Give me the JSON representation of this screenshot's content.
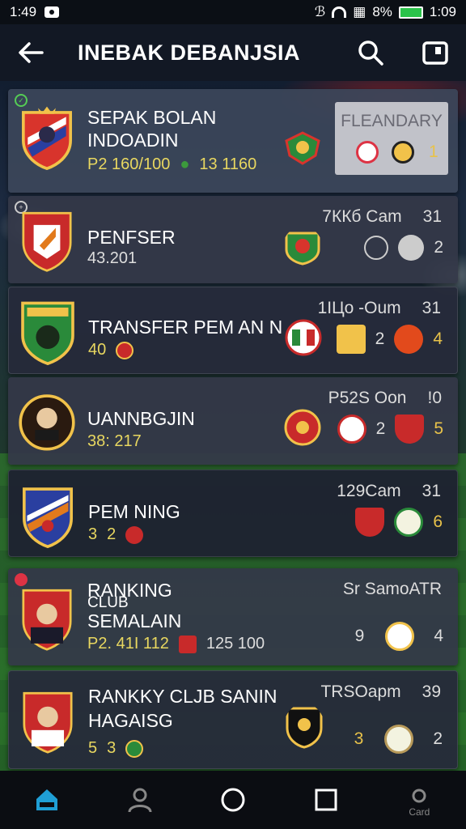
{
  "status_bar": {
    "time": "1:49",
    "battery": "8%",
    "time_right": "1:09"
  },
  "app_bar": {
    "title": "INEBAK DEBANJSIA",
    "icons": [
      "back-arrow-icon",
      "search-icon",
      "share-box-icon"
    ]
  },
  "featured": {
    "name_line1": "SEPAK BOLAN",
    "name_line2": "INDOADIN",
    "stat_a": "P2 160/100",
    "stat_b": "13 1160",
    "box_label": "FLEANDARY",
    "box_value": "1"
  },
  "rows": [
    {
      "name": "PENFSER",
      "sub": "43.201",
      "meta_label": "7ККб Cam",
      "meta_value": "31",
      "right_value": "2"
    },
    {
      "name": "TRANSFER PEM  AN N",
      "sub": "40",
      "meta_label": "1ІЦо -Oum",
      "meta_value": "31",
      "mid_value": "2",
      "right_value": "4"
    },
    {
      "name": "UANNBGJIN",
      "sub": "38: 217",
      "meta_label": "P52S Oon",
      "meta_value": "!0",
      "mid_value": "2",
      "right_value": "5"
    },
    {
      "name": "PEM NING",
      "sub_a": "3",
      "sub_b": "2",
      "meta_label": "129Cam",
      "meta_value": "31",
      "right_value": "6"
    },
    {
      "name_line1": "RANKING",
      "name_line1b": "CLUB",
      "name_line2": "SEMALAIN",
      "stat_a": "P2. 41I 112",
      "stat_b": "125 100",
      "meta_label": "Sr SamoATR",
      "mid_value": "9",
      "right_value": "4"
    },
    {
      "name_line1": "RANKKY CLJB SANIN",
      "name_line2": "HAGAISG",
      "sub_a": "5",
      "sub_b": "3",
      "meta_label": "TRSOapm",
      "meta_value": "39",
      "mid_value": "3",
      "right_value": "2"
    }
  ],
  "bottom_nav": {
    "last_label": "Card"
  },
  "colors": {
    "accent_yellow": "#e8c24a",
    "card_bg": "#343848",
    "topbar": "#121824"
  }
}
